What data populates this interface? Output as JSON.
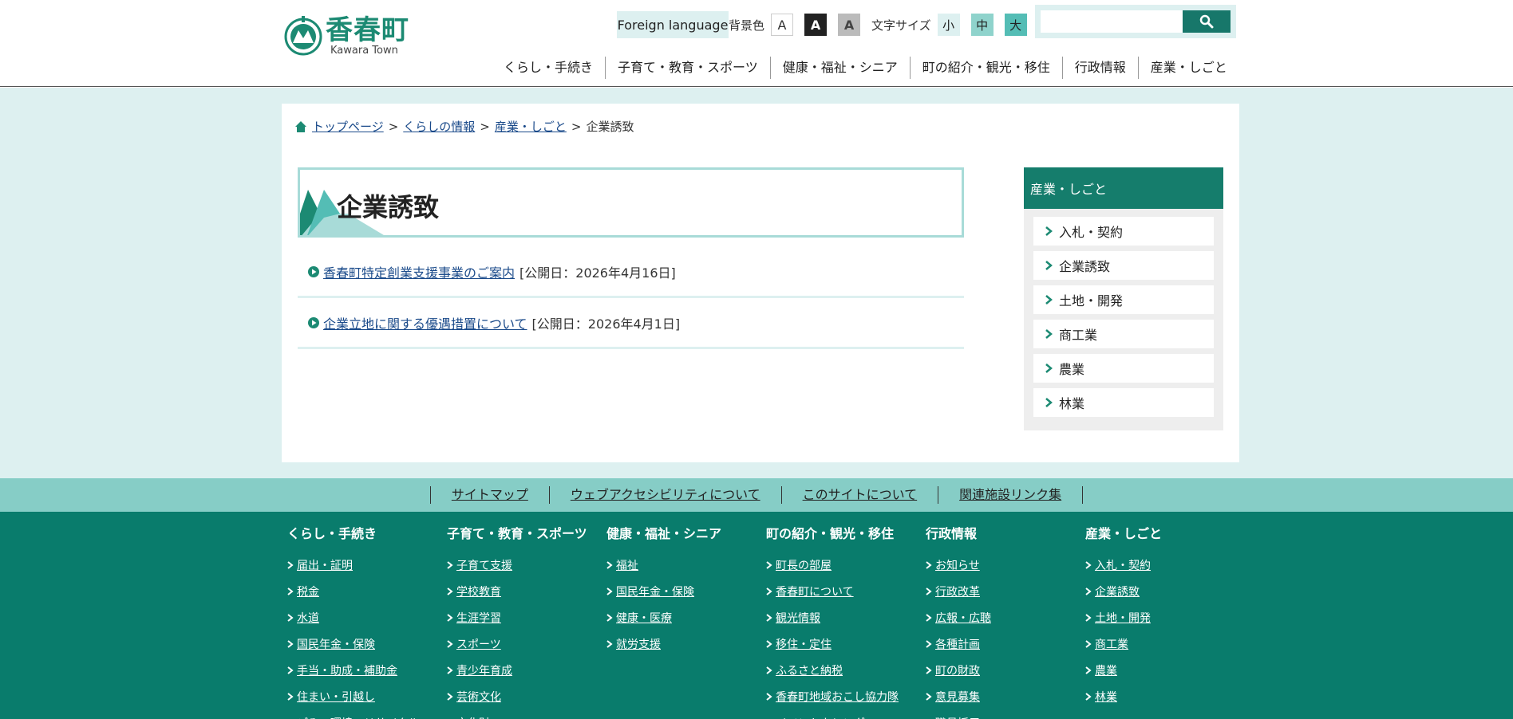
{
  "header": {
    "logo_title": "香春町",
    "logo_sub": "Kawara Town",
    "foreign_language": "Foreign language",
    "bg_label": "背景色",
    "bg_options": [
      "A",
      "A",
      "A"
    ],
    "font_size_label": "文字サイズ",
    "font_size_options": [
      "小",
      "中",
      "大"
    ],
    "search_value": "",
    "nav": [
      "くらし・手続き",
      "子育て・教育・スポーツ",
      "健康・福祉・シニア",
      "町の紹介・観光・移住",
      "行政情報",
      "産業・しごと"
    ]
  },
  "breadcrumb": {
    "items": [
      "トップページ",
      "くらしの情報",
      "産業・しごと"
    ],
    "separator": ">",
    "current": "企業誘致"
  },
  "page": {
    "title": "企業誘致",
    "news": [
      {
        "link": "香春町特定創業支援事業のご案内",
        "date": "[公開日：2026年4月16日]"
      },
      {
        "link": "企業立地に関する優遇措置について",
        "date": "[公開日：2026年4月1日]"
      }
    ]
  },
  "sidebar": {
    "title": "産業・しごと",
    "items": [
      "入札・契約",
      "企業誘致",
      "土地・開発",
      "商工業",
      "農業",
      "林業"
    ]
  },
  "footer_links": [
    "サイトマップ",
    "ウェブアクセシビリティについて",
    "このサイトについて",
    "関連施設リンク集"
  ],
  "footer_nav": [
    {
      "title": "くらし・手続き",
      "items": [
        "届出・証明",
        "税金",
        "水道",
        "国民年金・保険",
        "手当・助成・補助金",
        "住まい・引越し",
        "ごみ・環境・リサイクル"
      ]
    },
    {
      "title": "子育て・教育・スポーツ",
      "items": [
        "子育て支援",
        "学校教育",
        "生涯学習",
        "スポーツ",
        "青少年育成",
        "芸術文化",
        "文化財"
      ]
    },
    {
      "title": "健康・福祉・シニア",
      "items": [
        "福祉",
        "国民年金・保険",
        "健康・医療",
        "就労支援"
      ]
    },
    {
      "title": "町の紹介・観光・移住",
      "items": [
        "町長の部屋",
        "香春町について",
        "観光情報",
        "移住・定住",
        "ふるさと納税",
        "香春町地域おこし協力隊",
        "イベントカレンダー"
      ]
    },
    {
      "title": "行政情報",
      "items": [
        "お知らせ",
        "行政改革",
        "広報・広聴",
        "各種計画",
        "町の財政",
        "意見募集",
        "職員採用"
      ]
    },
    {
      "title": "産業・しごと",
      "items": [
        "入札・契約",
        "企業誘致",
        "土地・開発",
        "商工業",
        "農業",
        "林業"
      ]
    }
  ],
  "colors": {
    "brand": "#097c6c",
    "accent_light": "#ddf0f0",
    "link": "#1a4a8a"
  }
}
